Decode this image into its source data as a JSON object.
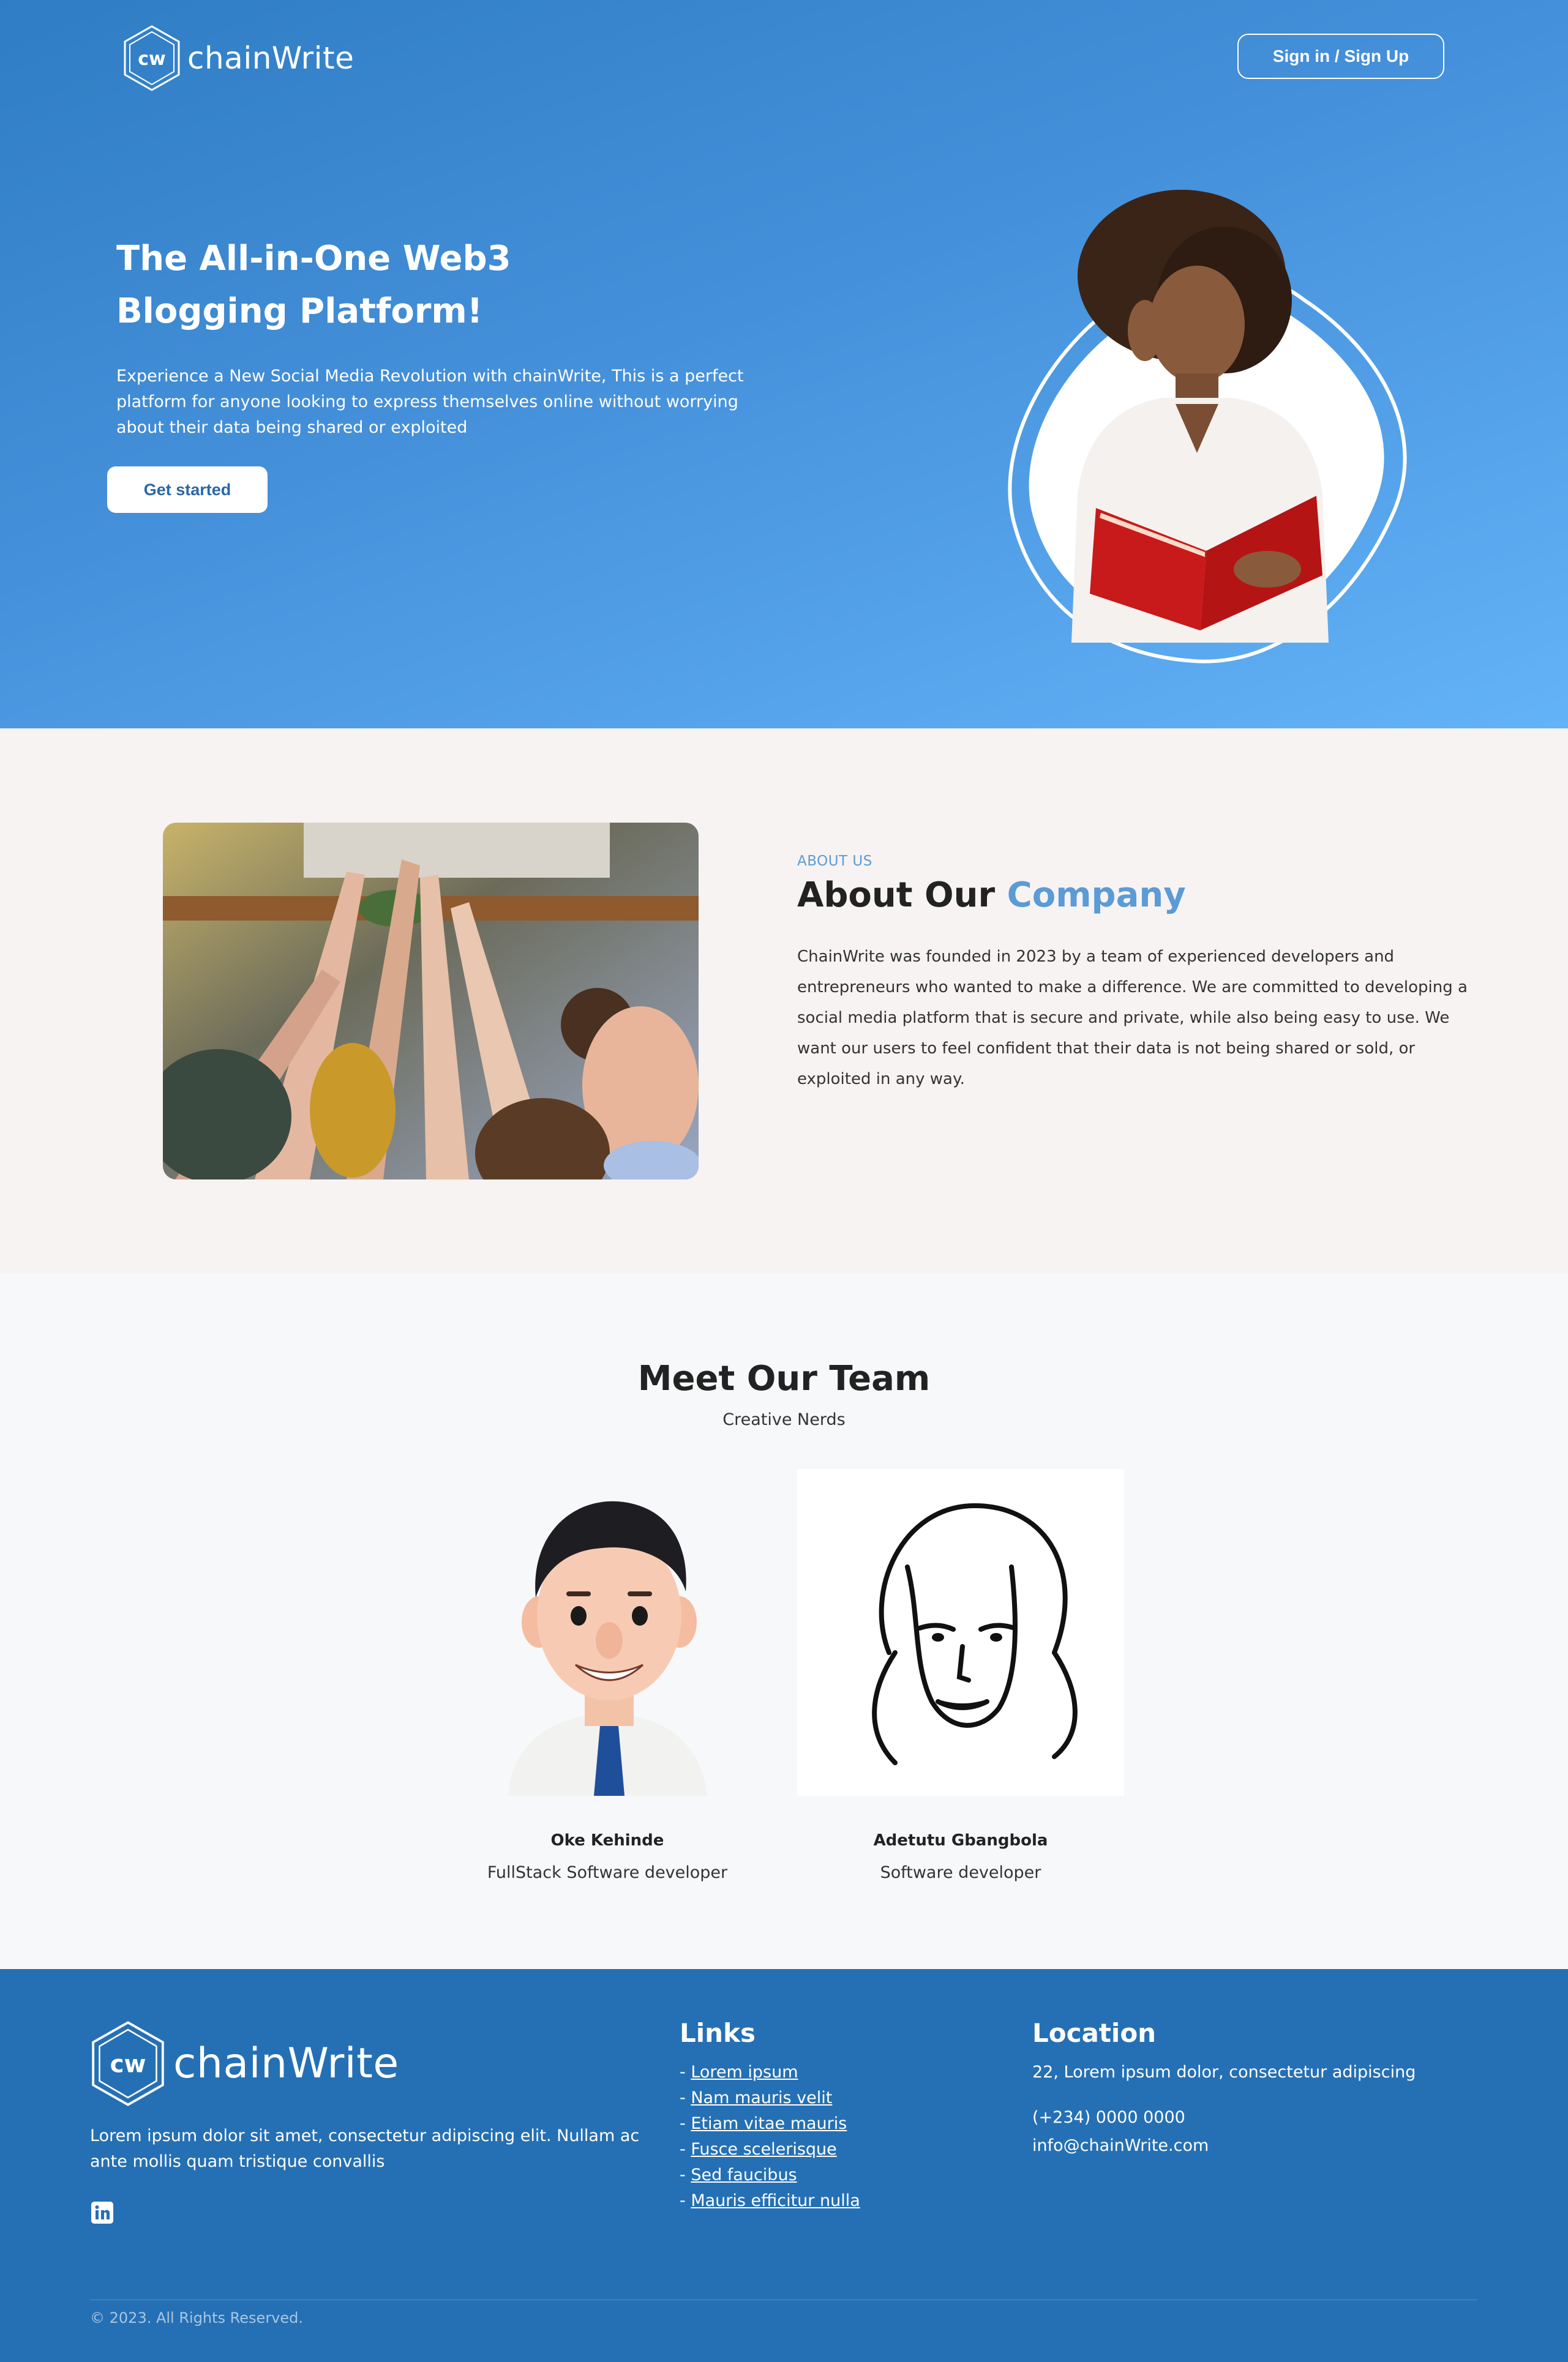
{
  "brand": {
    "name": "chainWrite",
    "mark": "cw"
  },
  "header": {
    "signin_label": "Sign in / Sign Up"
  },
  "hero": {
    "title": "The All-in-One Web3 Blogging Platform!",
    "description": "Experience a New Social Media Revolution with chainWrite, This is a perfect platform for anyone looking to express themselves online without worrying about their data being shared or exploited",
    "cta_label": "Get started"
  },
  "about": {
    "eyebrow": "ABOUT US",
    "title_prefix": "About Our",
    "title_accent": "Company",
    "body": "ChainWrite was founded in 2023 by a team of experienced developers and entrepreneurs who wanted to make a difference. We are committed to developing a social media platform that is secure and private, while also being easy to use. We want our users to feel confident that their data is not being shared or sold, or exploited in any way."
  },
  "team": {
    "title": "Meet Our Team",
    "subtitle": "Creative Nerds",
    "members": [
      {
        "name": "Oke Kehinde",
        "role": "FullStack Software developer"
      },
      {
        "name": "Adetutu Gbangbola",
        "role": "Software developer"
      }
    ]
  },
  "footer": {
    "about": "Lorem ipsum dolor sit amet, consectetur adipiscing elit. Nullam ac ante mollis quam tristique convallis",
    "links_title": "Links",
    "links": [
      "Lorem ipsum",
      "Nam mauris velit",
      "Etiam vitae mauris",
      "Fusce scelerisque",
      "Sed faucibus",
      "Mauris efficitur nulla"
    ],
    "link_prefix": "- ",
    "location_title": "Location",
    "address": "22, Lorem ipsum dolor, consectetur adipiscing",
    "phone": "(+234) 0000 0000",
    "email": "info@chainWrite.com",
    "copyright": "© 2023. All Rights Reserved."
  },
  "colors": {
    "primary": "#2570b4",
    "accent": "#5b9bd6",
    "hero_start": "#2f7dc4",
    "hero_end": "#63b3f8"
  }
}
